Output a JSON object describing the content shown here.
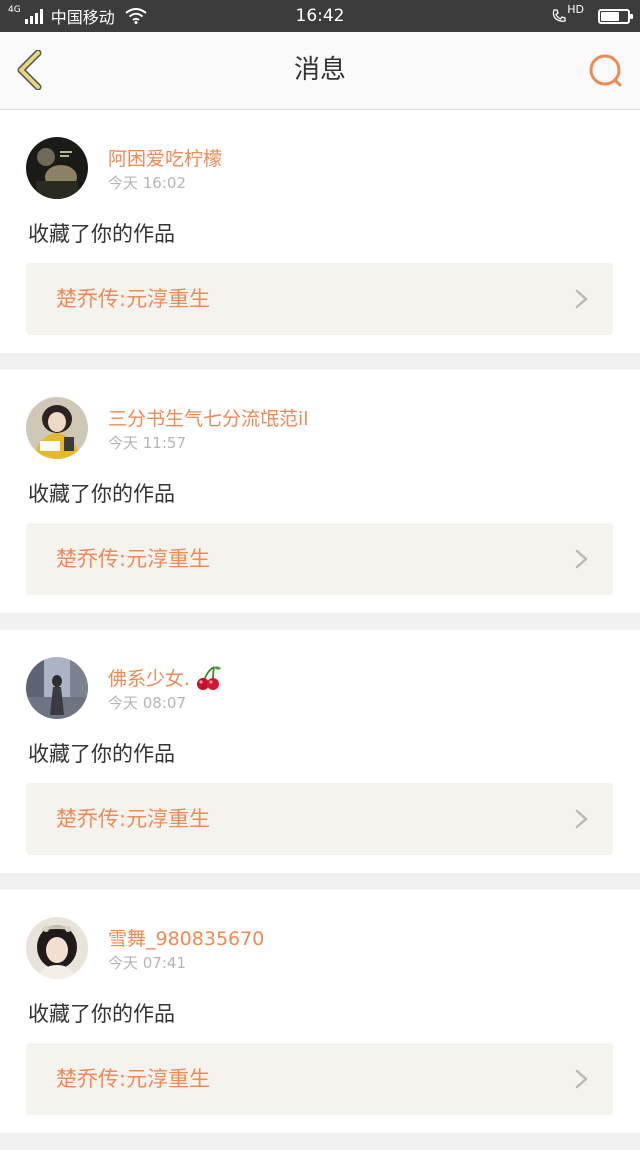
{
  "status_bar": {
    "network": "4G",
    "carrier": "中国移动",
    "time": "16:42",
    "hd_label": "HD",
    "battery_level": 0.65
  },
  "nav": {
    "title": "消息",
    "back_icon": "chevron-left-icon",
    "search_icon": "search-icon",
    "accent_color": "#ee8a55",
    "back_color": "#e8d77a"
  },
  "messages": [
    {
      "username": "阿困爱吃柠檬",
      "time": "今天 16:02",
      "action": "收藏了你的作品",
      "work_title": "楚乔传:元淳重生"
    },
    {
      "username": "三分书生气七分流氓范il",
      "time": "今天 11:57",
      "action": "收藏了你的作品",
      "work_title": "楚乔传:元淳重生"
    },
    {
      "username": "佛系少女.",
      "username_icon": "cherry-icon",
      "time": "今天 08:07",
      "action": "收藏了你的作品",
      "work_title": "楚乔传:元淳重生"
    },
    {
      "username": "雪舞_980835670",
      "time": "今天 07:41",
      "action": "收藏了你的作品",
      "work_title": "楚乔传:元淳重生"
    }
  ]
}
